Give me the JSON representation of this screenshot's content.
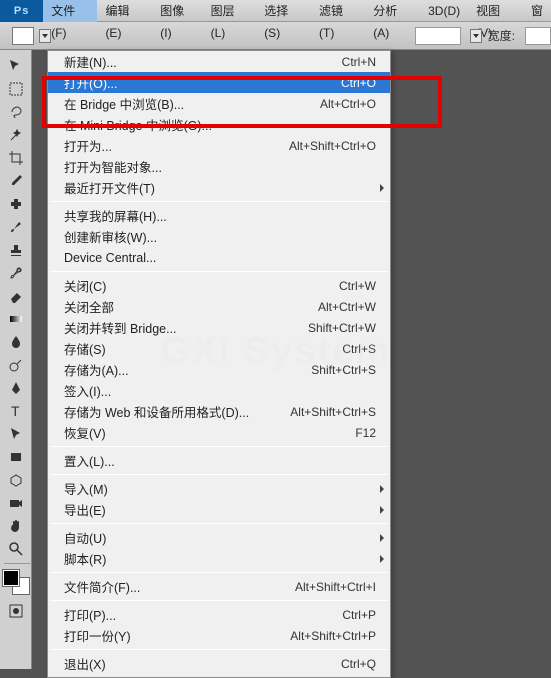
{
  "menubar": {
    "items": [
      "文件(F)",
      "编辑(E)",
      "图像(I)",
      "图层(L)",
      "选择(S)",
      "滤镜(T)",
      "分析(A)",
      "3D(D)",
      "视图(V)",
      "窗"
    ]
  },
  "optbar": {
    "width_label": "宽度:"
  },
  "dropdown": {
    "items": [
      {
        "type": "item",
        "label": "新建(N)...",
        "shortcut": "Ctrl+N"
      },
      {
        "type": "item",
        "label": "打开(O)...",
        "shortcut": "Ctrl+O",
        "highlight": true
      },
      {
        "type": "item",
        "label": "在 Bridge 中浏览(B)...",
        "shortcut": "Alt+Ctrl+O"
      },
      {
        "type": "item",
        "label": "在 Mini Bridge 中浏览(G)..."
      },
      {
        "type": "item",
        "label": "打开为...",
        "shortcut": "Alt+Shift+Ctrl+O"
      },
      {
        "type": "item",
        "label": "打开为智能对象..."
      },
      {
        "type": "item",
        "label": "最近打开文件(T)",
        "submenu": true
      },
      {
        "type": "sep"
      },
      {
        "type": "item",
        "label": "共享我的屏幕(H)..."
      },
      {
        "type": "item",
        "label": "创建新审核(W)..."
      },
      {
        "type": "item",
        "label": "Device Central..."
      },
      {
        "type": "sep"
      },
      {
        "type": "item",
        "label": "关闭(C)",
        "shortcut": "Ctrl+W"
      },
      {
        "type": "item",
        "label": "关闭全部",
        "shortcut": "Alt+Ctrl+W"
      },
      {
        "type": "item",
        "label": "关闭并转到 Bridge...",
        "shortcut": "Shift+Ctrl+W"
      },
      {
        "type": "item",
        "label": "存储(S)",
        "shortcut": "Ctrl+S"
      },
      {
        "type": "item",
        "label": "存储为(A)...",
        "shortcut": "Shift+Ctrl+S"
      },
      {
        "type": "item",
        "label": "签入(I)..."
      },
      {
        "type": "item",
        "label": "存储为 Web 和设备所用格式(D)...",
        "shortcut": "Alt+Shift+Ctrl+S"
      },
      {
        "type": "item",
        "label": "恢复(V)",
        "shortcut": "F12"
      },
      {
        "type": "sep"
      },
      {
        "type": "item",
        "label": "置入(L)..."
      },
      {
        "type": "sep"
      },
      {
        "type": "item",
        "label": "导入(M)",
        "submenu": true
      },
      {
        "type": "item",
        "label": "导出(E)",
        "submenu": true
      },
      {
        "type": "sep"
      },
      {
        "type": "item",
        "label": "自动(U)",
        "submenu": true
      },
      {
        "type": "item",
        "label": "脚本(R)",
        "submenu": true
      },
      {
        "type": "sep"
      },
      {
        "type": "item",
        "label": "文件简介(F)...",
        "shortcut": "Alt+Shift+Ctrl+I"
      },
      {
        "type": "sep"
      },
      {
        "type": "item",
        "label": "打印(P)...",
        "shortcut": "Ctrl+P"
      },
      {
        "type": "item",
        "label": "打印一份(Y)",
        "shortcut": "Alt+Shift+Ctrl+P"
      },
      {
        "type": "sep"
      },
      {
        "type": "item",
        "label": "退出(X)",
        "shortcut": "Ctrl+Q"
      }
    ]
  },
  "watermark": "GXI System",
  "tools": [
    "move",
    "marquee",
    "lasso",
    "wand",
    "crop",
    "eyedropper",
    "heal",
    "brush",
    "stamp",
    "history-brush",
    "eraser",
    "gradient",
    "blur",
    "dodge",
    "pen",
    "type",
    "path-select",
    "rectangle",
    "hand",
    "zoom",
    "rotate"
  ]
}
